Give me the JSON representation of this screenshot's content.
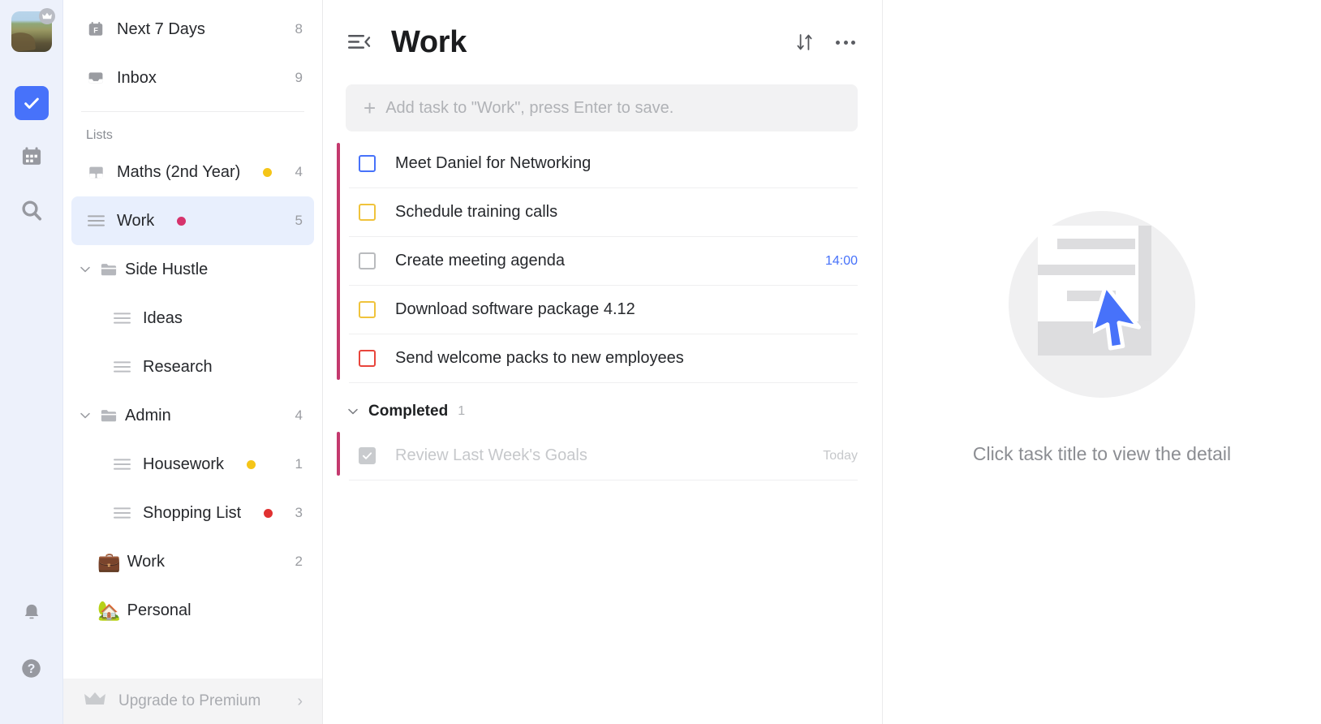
{
  "rail": {
    "avatar": {
      "name": "user-avatar",
      "badge": "crown-icon"
    },
    "icons": [
      {
        "name": "tasks-icon",
        "label": "Tasks",
        "active": true
      },
      {
        "name": "calendar-icon",
        "label": "Calendar",
        "active": false
      },
      {
        "name": "search-icon",
        "label": "Search",
        "active": false
      }
    ],
    "bottom_icons": [
      {
        "name": "bell-icon",
        "label": "Notifications"
      },
      {
        "name": "help-icon",
        "label": "Help"
      }
    ]
  },
  "sidebar": {
    "smart_lists": [
      {
        "icon": "calendar-f-icon",
        "label": "Next 7 Days",
        "count": "8"
      },
      {
        "icon": "inbox-icon",
        "label": "Inbox",
        "count": "9"
      }
    ],
    "section_label": "Lists",
    "lists": [
      {
        "icon": "note-icon",
        "label": "Maths (2nd Year)",
        "dot": "#f5c518",
        "count": "4",
        "type": "list",
        "selected": false
      },
      {
        "icon": "list-icon",
        "label": "Work",
        "dot": "#d6336c",
        "count": "5",
        "type": "list",
        "selected": true
      },
      {
        "icon": "folder-icon",
        "label": "Side Hustle",
        "dot": "",
        "count": "",
        "type": "folder",
        "expanded": true
      },
      {
        "icon": "list-icon",
        "label": "Ideas",
        "dot": "",
        "count": "",
        "type": "child"
      },
      {
        "icon": "list-icon",
        "label": "Research",
        "dot": "",
        "count": "",
        "type": "child"
      },
      {
        "icon": "folder-icon",
        "label": "Admin",
        "dot": "",
        "count": "4",
        "type": "folder",
        "expanded": true
      },
      {
        "icon": "list-icon",
        "label": "Housework",
        "dot": "#f5c518",
        "count": "1",
        "type": "child"
      },
      {
        "icon": "list-icon",
        "label": "Shopping List",
        "dot": "#e03131",
        "count": "3",
        "type": "child"
      },
      {
        "icon": "briefcase-emoji",
        "label": "Work",
        "dot": "",
        "count": "2",
        "type": "emoji",
        "emoji": "💼"
      },
      {
        "icon": "house-emoji",
        "label": "Personal",
        "dot": "",
        "count": "",
        "type": "emoji",
        "emoji": "🏡"
      }
    ],
    "upgrade": {
      "icon": "crown-icon",
      "label": "Upgrade to Premium",
      "arrow": "›"
    }
  },
  "main": {
    "collapse_icon": "collapse-sidebar-icon",
    "title": "Work",
    "sort_icon": "sort-icon",
    "more_icon": "more-options-icon",
    "add_task_placeholder": "Add task to \"Work\", press Enter to save.",
    "accent_color": "#c4396e",
    "tasks": [
      {
        "title": "Meet Daniel for Networking",
        "checkbox_color": "#4772fa",
        "date": ""
      },
      {
        "title": "Schedule training calls",
        "checkbox_color": "#f0c33c",
        "date": ""
      },
      {
        "title": "Create meeting agenda",
        "checkbox_color": "#b9bbbe",
        "date": "14:00"
      },
      {
        "title": "Download software package 4.12",
        "checkbox_color": "#f0c33c",
        "date": ""
      },
      {
        "title": "Send welcome packs to new employees",
        "checkbox_color": "#e8453c",
        "date": ""
      }
    ],
    "completed_section": {
      "label": "Completed",
      "count": "1"
    },
    "completed_tasks": [
      {
        "title": "Review Last Week's Goals",
        "date": "Today"
      }
    ]
  },
  "detail": {
    "illustration": "document-cursor-illustration",
    "empty_message": "Click task title to view the detail"
  }
}
